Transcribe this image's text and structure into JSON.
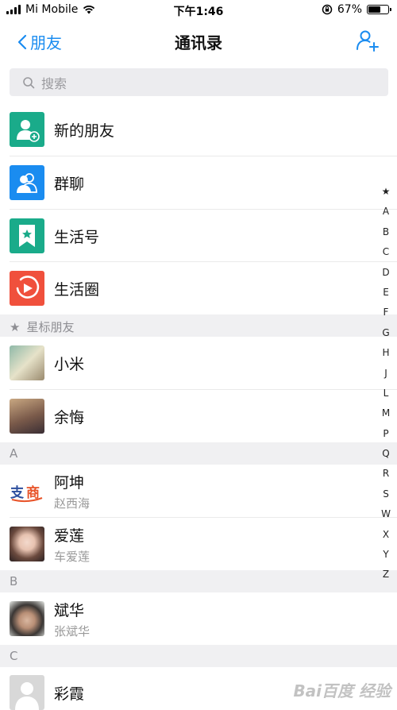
{
  "status": {
    "carrier": "Mi Mobile",
    "time": "下午1:46",
    "battery": "67%",
    "battery_level": 0.67
  },
  "nav": {
    "back_label": "朋友",
    "title": "通讯录"
  },
  "search": {
    "placeholder": "搜索"
  },
  "menu": [
    {
      "label": "新的朋友",
      "icon": "add-friend-icon",
      "color": "#1aab8a"
    },
    {
      "label": "群聊",
      "icon": "group-chat-icon",
      "color": "#1a8cf0"
    },
    {
      "label": "生活号",
      "icon": "bookmark-star-icon",
      "color": "#1aab8a"
    },
    {
      "label": "生活圈",
      "icon": "play-circle-icon",
      "color": "#f0503c"
    }
  ],
  "starred": {
    "header": "星标朋友",
    "contacts": [
      {
        "name": "小米"
      },
      {
        "name": "余悔"
      }
    ]
  },
  "sections": [
    {
      "letter": "A",
      "contacts": [
        {
          "name": "阿坤",
          "sub": "赵西海"
        },
        {
          "name": "爱莲",
          "sub": "车爱莲"
        }
      ]
    },
    {
      "letter": "B",
      "contacts": [
        {
          "name": "斌华",
          "sub": "张斌华"
        }
      ]
    },
    {
      "letter": "C",
      "contacts": [
        {
          "name": "彩霞"
        }
      ]
    }
  ],
  "index_letters": [
    "★",
    "A",
    "B",
    "C",
    "D",
    "E",
    "F",
    "G",
    "H",
    "J",
    "L",
    "M",
    "P",
    "Q",
    "R",
    "S",
    "W",
    "X",
    "Y",
    "Z"
  ],
  "watermark": "Bai百度 经验"
}
